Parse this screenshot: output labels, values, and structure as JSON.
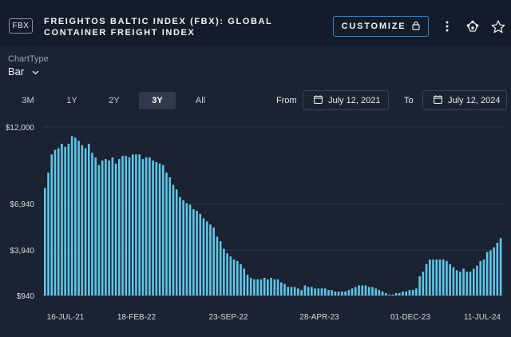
{
  "header": {
    "ticker": "FBX",
    "title": "FREIGHTOS BALTIC INDEX (FBX): GLOBAL CONTAINER FREIGHT INDEX",
    "customize_label": "CUSTOMIZE",
    "icons": [
      "lock-icon",
      "more-vertical-icon",
      "share-icon",
      "star-icon"
    ]
  },
  "controls": {
    "chart_type_label": "ChartType",
    "chart_type_value": "Bar",
    "ranges": [
      "3M",
      "1Y",
      "2Y",
      "3Y",
      "All"
    ],
    "active_range": "3Y",
    "from_label": "From",
    "from_date": "July 12, 2021",
    "to_label": "To",
    "to_date": "July 12, 2024"
  },
  "colors": {
    "bar": "#5fc6e8",
    "background": "#1b2232",
    "header_background": "#141c2b",
    "accent": "#3b82c8"
  },
  "chart_data": {
    "type": "bar",
    "y_ticks": [
      "$12,000",
      "$6,940",
      "$3,940",
      "$940"
    ],
    "ylim": [
      940,
      12000
    ],
    "x_ticks": [
      "16-JUL-21",
      "18-FEB-22",
      "23-SEP-22",
      "28-APR-23",
      "01-DEC-23",
      "11-JUL-24"
    ],
    "grid": true,
    "values": [
      8000,
      9000,
      10200,
      10500,
      10600,
      10900,
      10700,
      10900,
      11400,
      11300,
      11100,
      10800,
      10600,
      10900,
      10300,
      10000,
      9500,
      9800,
      9900,
      9800,
      10000,
      9600,
      9900,
      10100,
      10100,
      10000,
      10200,
      10200,
      10200,
      9900,
      10000,
      10000,
      9800,
      9700,
      9600,
      9500,
      9000,
      8700,
      8200,
      7900,
      7400,
      7200,
      7000,
      6900,
      6600,
      6500,
      6300,
      6000,
      5800,
      5600,
      5400,
      4800,
      4500,
      4000,
      3700,
      3500,
      3300,
      3200,
      3000,
      2700,
      2300,
      2100,
      2000,
      2000,
      2000,
      2100,
      2000,
      2100,
      2000,
      2000,
      1800,
      1700,
      1500,
      1500,
      1500,
      1400,
      1300,
      1600,
      1500,
      1500,
      1400,
      1400,
      1400,
      1400,
      1300,
      1300,
      1200,
      1200,
      1200,
      1200,
      1300,
      1400,
      1500,
      1600,
      1600,
      1600,
      1500,
      1500,
      1400,
      1300,
      1200,
      1100,
      1000,
      1000,
      1100,
      1100,
      1200,
      1200,
      1300,
      1300,
      1400,
      2200,
      2500,
      3000,
      3300,
      3300,
      3300,
      3300,
      3300,
      3200,
      3000,
      2800,
      2600,
      2500,
      2700,
      2500,
      2500,
      2700,
      2900,
      3200,
      3300,
      3800,
      3900,
      4100,
      4400,
      4700
    ]
  }
}
